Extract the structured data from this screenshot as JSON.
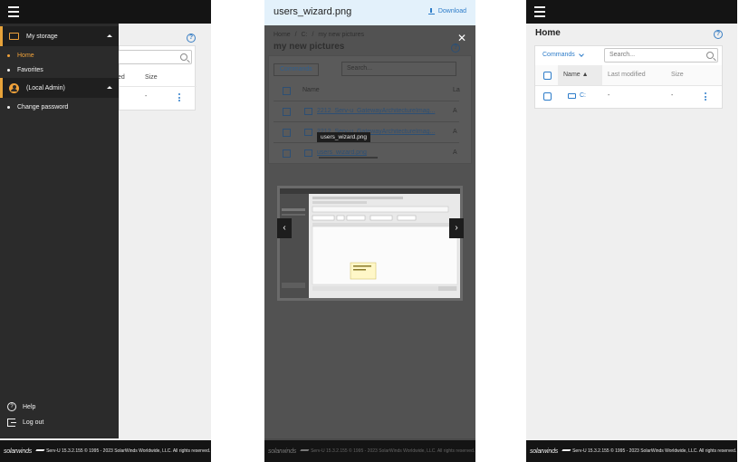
{
  "panel1": {
    "drawer": {
      "storage_label": "My storage",
      "home_label": "Home",
      "favorites_label": "Favorites",
      "user_label": "(Local Admin)",
      "change_password_label": "Change password",
      "help_label": "Help",
      "logout_label": "Log out"
    },
    "behind": {
      "help_icon": "?",
      "col_modified_fragment": "ed",
      "col_size": "Size",
      "row_size": "-"
    },
    "footer": {
      "logo": "solarwinds",
      "text": "Serv-U 15.3.2.155 © 1995 - 2023 SolarWinds Worldwide, LLC. All rights reserved."
    }
  },
  "panel2": {
    "viewer_title": "users_wizard.png",
    "download_label": "Download",
    "close_icon": "✕",
    "breadcrumb": {
      "home": "Home",
      "sep": "/",
      "drive": "C:",
      "folder": "my new pictures"
    },
    "folder_title": "my new pictures",
    "help_icon": "?",
    "commands_label": "Commands",
    "search_placeholder": "Search...",
    "col_name": "Name",
    "col_last_fragment": "La",
    "files": [
      {
        "name": "2212_Serv-u_GatewayArchitectureImag...",
        "col": "A"
      },
      {
        "name": "2212_Serv-u_GatewayArchitectureImag...",
        "col": "A"
      },
      {
        "name": "users_wizard.png",
        "col": "A"
      }
    ],
    "tooltip": "users_wizard.png",
    "prev_icon": "‹",
    "next_icon": "›",
    "footer": {
      "logo": "solarwinds",
      "text": "Serv-U 15.3.2.155 © 1995 - 2023 SolarWinds Worldwide, LLC. All rights reserved."
    }
  },
  "panel3": {
    "page_title": "Home",
    "help_icon": "?",
    "commands_label": "Commands",
    "search_placeholder": "Search...",
    "columns": {
      "name": "Name",
      "modified": "Last modified",
      "size": "Size"
    },
    "row": {
      "name": "C:",
      "modified": "-",
      "size": "-"
    },
    "footer": {
      "logo": "solarwinds",
      "text": "Serv-U 15.3.2.155 © 1995 - 2023 SolarWinds Worldwide, LLC. All rights reserved."
    }
  }
}
